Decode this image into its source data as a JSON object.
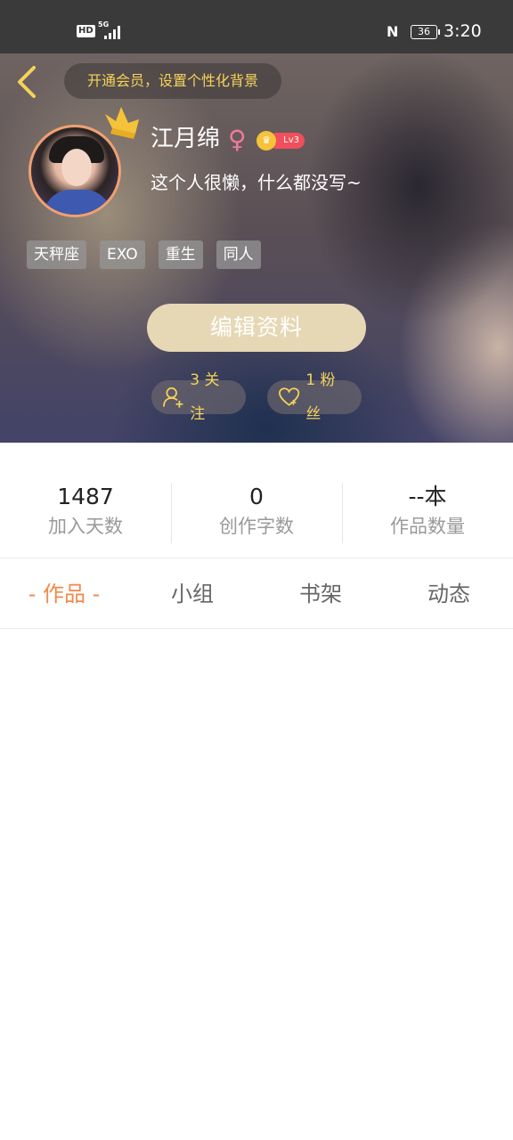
{
  "status_bar": {
    "hd": "HD",
    "network": "5G",
    "battery": "36",
    "time": "3:20"
  },
  "profile": {
    "vip_banner": "开通会员，设置个性化背景",
    "username": "江月绵",
    "gender_symbol": "♀",
    "level": "Lv3",
    "bio": "这个人很懒，什么都没写~",
    "tags": [
      "天秤座",
      "EXO",
      "重生",
      "同人"
    ],
    "edit_button": "编辑资料",
    "following": "3 关注",
    "fans": "1 粉丝"
  },
  "stats": [
    {
      "value": "1487",
      "label": "加入天数"
    },
    {
      "value": "0",
      "label": "创作字数"
    },
    {
      "value": "--本",
      "label": "作品数量"
    }
  ],
  "tabs": [
    {
      "label": "- 作品 -",
      "active": true
    },
    {
      "label": "小组",
      "active": false
    },
    {
      "label": "书架",
      "active": false
    },
    {
      "label": "动态",
      "active": false
    }
  ],
  "colors": {
    "accent": "#ef8a4a",
    "gold_text": "#f5d35a",
    "edit_button_bg": "#e6d8b5",
    "level_badge": "#f04f5b"
  }
}
